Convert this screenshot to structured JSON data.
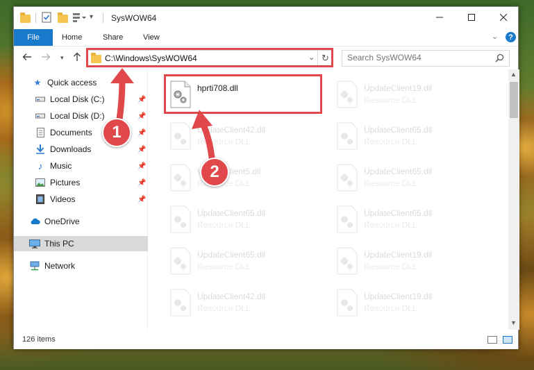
{
  "window": {
    "title": "SysWOW64"
  },
  "ribbon": {
    "tabs": [
      {
        "label": "File"
      },
      {
        "label": "Home"
      },
      {
        "label": "Share"
      },
      {
        "label": "View"
      }
    ]
  },
  "address": {
    "path": "C:\\Windows\\SysWOW64"
  },
  "search": {
    "placeholder": "Search SysWOW64"
  },
  "nav_pane": {
    "items": [
      {
        "label": "Quick access",
        "icon": "star-icon"
      },
      {
        "label": "Local Disk (C:)",
        "icon": "drive-icon",
        "pinned": true
      },
      {
        "label": "Local Disk (D:)",
        "icon": "drive-icon",
        "pinned": true
      },
      {
        "label": "Documents",
        "icon": "documents-icon",
        "pinned": true
      },
      {
        "label": "Downloads",
        "icon": "download-arrow-icon",
        "pinned": true
      },
      {
        "label": "Music",
        "icon": "music-note-icon",
        "pinned": true
      },
      {
        "label": "Pictures",
        "icon": "pictures-icon",
        "pinned": true
      },
      {
        "label": "Videos",
        "icon": "video-icon",
        "pinned": true
      },
      {
        "label": "OneDrive",
        "icon": "cloud-icon"
      },
      {
        "label": "This PC",
        "icon": "monitor-icon",
        "selected": true
      },
      {
        "label": "Network",
        "icon": "network-icon"
      }
    ]
  },
  "files": [
    {
      "name": "hprti708.dll",
      "type": "",
      "highlighted": true
    },
    {
      "name": "UpdateClient19.dll",
      "type": "Resource DLL"
    },
    {
      "name": "UpdateClient42.dll",
      "type": "Resource DLL"
    },
    {
      "name": "UpdateClient65.dll",
      "type": "Resource DLL"
    },
    {
      "name": "UpdateClient5.dll",
      "type": "Resource DLL"
    },
    {
      "name": "UpdateClient65.dll",
      "type": "Resource DLL"
    },
    {
      "name": "UpdateClient65.dll",
      "type": "Resource DLL"
    },
    {
      "name": "UpdateClient65.dll",
      "type": "Resource DLL"
    },
    {
      "name": "UpdateClient65.dll",
      "type": "Resource DLL"
    },
    {
      "name": "UpdateClient19.dll",
      "type": "Resource DLL"
    },
    {
      "name": "UpdateClient42.dll",
      "type": "Resource DLL"
    },
    {
      "name": "UpdateClient19.dll",
      "type": "Resource DLL"
    }
  ],
  "status": {
    "item_count": "126 items"
  },
  "annotations": {
    "step1": "1",
    "step2": "2",
    "color": "#e0484c"
  },
  "colors": {
    "accent": "#1979ca",
    "selection": "#d9d9d9"
  }
}
